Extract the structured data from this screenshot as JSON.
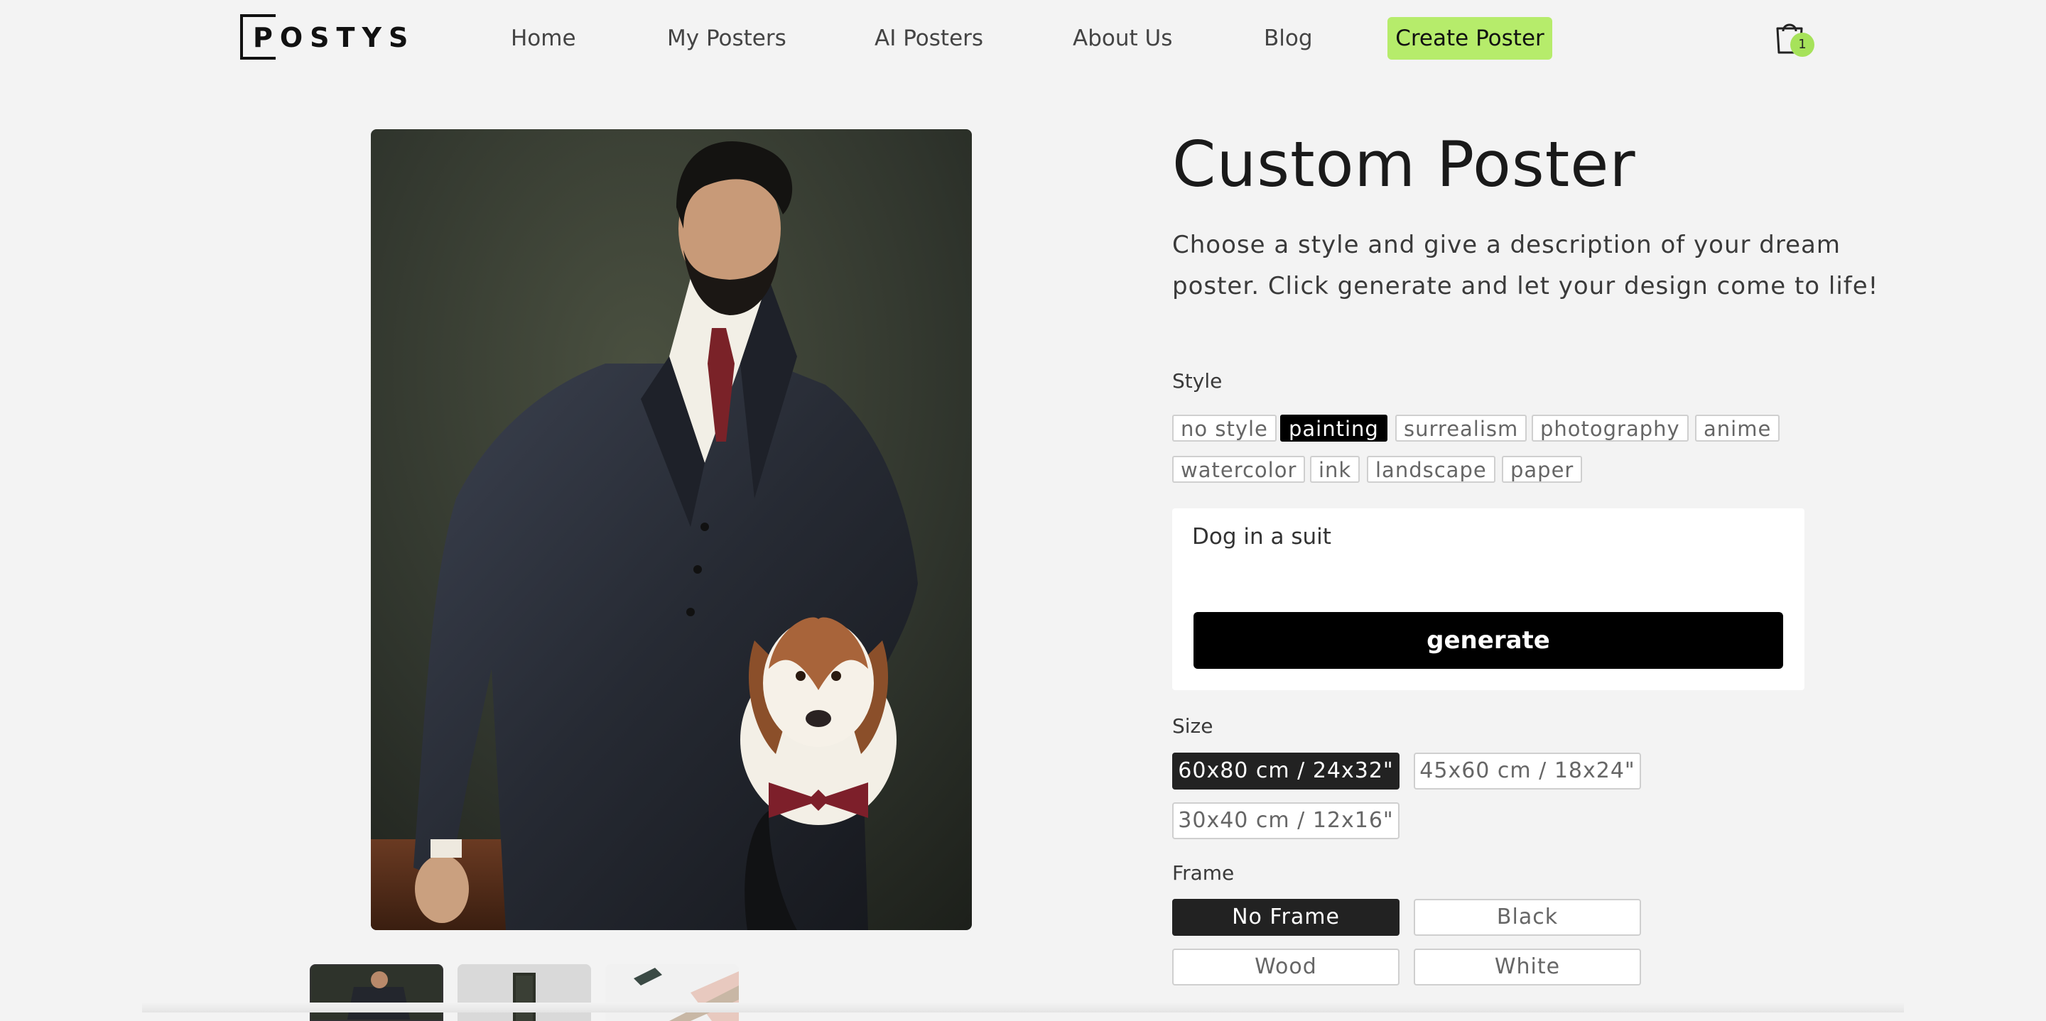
{
  "brand": {
    "name": "POSTYS"
  },
  "nav": {
    "items": [
      "Home",
      "My Posters",
      "AI Posters",
      "About Us",
      "Blog"
    ],
    "cta": "Create Poster"
  },
  "cart": {
    "count": "1"
  },
  "product": {
    "title": "Custom Poster",
    "description": "Choose a style and give a description of your dream poster. Click generate and let your design come to life!"
  },
  "style": {
    "label": "Style",
    "options": [
      "no style",
      "painting",
      "surrealism",
      "photography",
      "anime",
      "watercolor",
      "ink",
      "landscape",
      "paper"
    ],
    "selected": "painting"
  },
  "prompt": {
    "value": "Dog in a suit",
    "button": "generate"
  },
  "size": {
    "label": "Size",
    "options": [
      "60x80 cm / 24x32\"",
      "45x60 cm / 18x24\"",
      "30x40 cm / 12x16\""
    ],
    "selected": "60x80 cm / 24x32\""
  },
  "frame": {
    "label": "Frame",
    "options": [
      "No Frame",
      "Black",
      "Wood",
      "White"
    ],
    "selected": "No Frame"
  },
  "colors": {
    "accent": "#b6ec6b",
    "primary": "#000000"
  }
}
